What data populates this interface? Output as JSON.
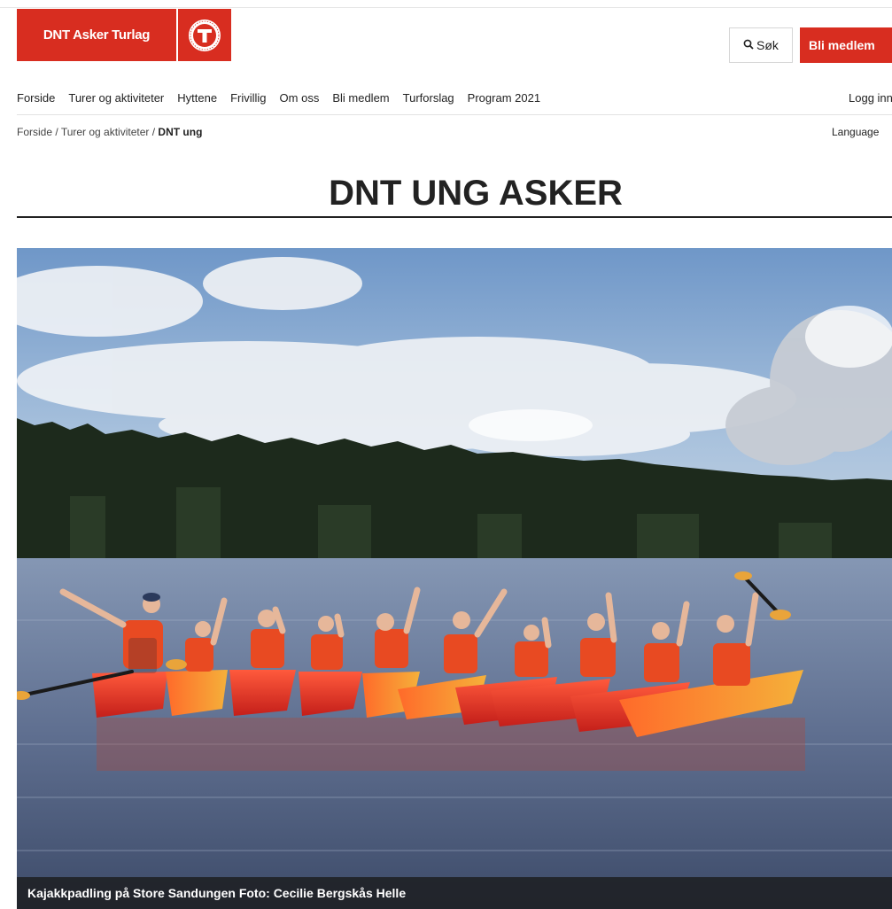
{
  "header": {
    "logo_text": "DNT Asker Turlag",
    "search_label": "Søk",
    "member_label": "Bli medlem"
  },
  "nav": {
    "items": [
      "Forside",
      "Turer og aktiviteter",
      "Hyttene",
      "Frivillig",
      "Om oss",
      "Bli medlem",
      "Turforslag",
      "Program 2021"
    ],
    "login_label": "Logg inn"
  },
  "breadcrumb": {
    "items": [
      "Forside",
      "Turer og aktiviteter"
    ],
    "separator": "/",
    "current": "DNT ung"
  },
  "language_label": "Language",
  "page_title": "DNT UNG ASKER",
  "hero": {
    "caption": "Kajakkpadling på Store Sandungen Foto: Cecilie Bergskås Helle"
  },
  "colors": {
    "brand_red": "#d82d20",
    "text": "#222222"
  },
  "icons": {
    "search": "search-icon",
    "logo_badge": "dnt-t-badge-icon"
  }
}
